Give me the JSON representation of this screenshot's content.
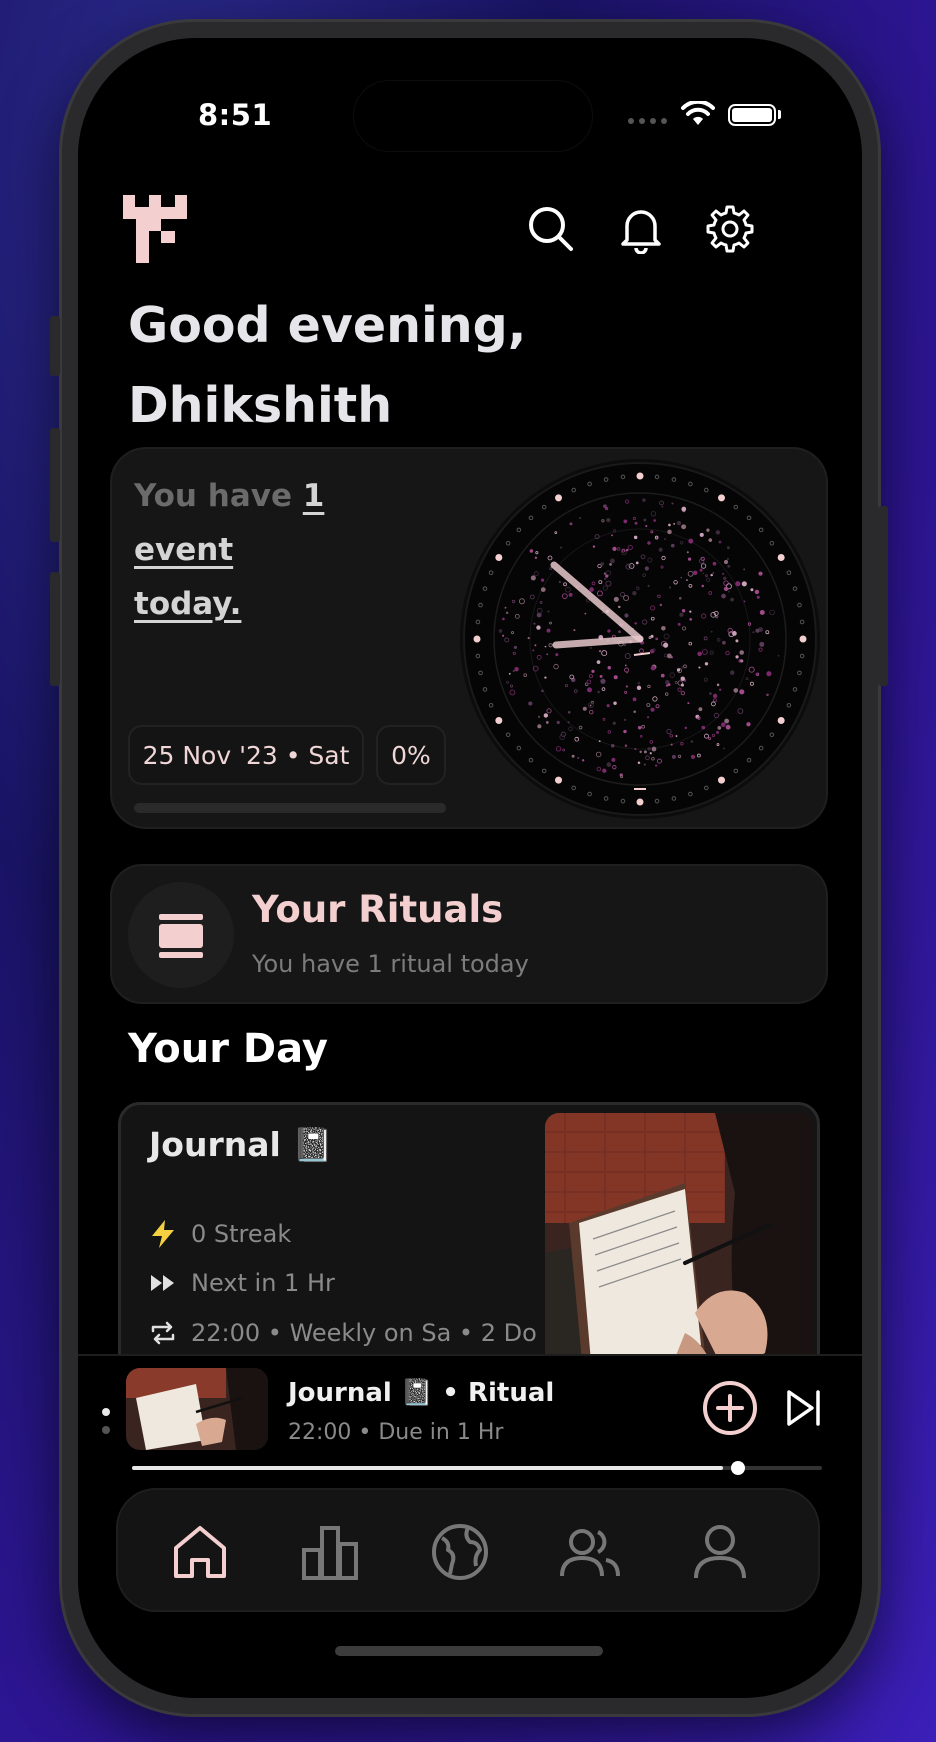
{
  "status_bar": {
    "time": "8:51"
  },
  "header": {
    "greeting_line1": "Good evening,",
    "greeting_line2": "Dhikshith",
    "icons": [
      "app-logo-icon",
      "search-icon",
      "bell-icon",
      "gear-icon"
    ]
  },
  "event_card": {
    "prefix": "You have ",
    "highlight_1": "1 event",
    "highlight_2": "today.",
    "date_pill": "25 Nov '23 • Sat",
    "percent_pill": "0%",
    "progress": 0
  },
  "rituals_card": {
    "title": "Your Rituals",
    "subtitle": "You have 1 ritual today"
  },
  "section_title": "Your Day",
  "journal_card": {
    "title": "Journal 📓",
    "streak": "0 Streak",
    "next": "Next in 1 Hr",
    "schedule": "22:00 • Weekly on Sa • 2 Do"
  },
  "mini_player": {
    "title": "Journal 📓  • Ritual",
    "subtitle": "22:00 • Due in 1 Hr",
    "progress": 0.9
  },
  "tabs": [
    "home-icon",
    "chart-icon",
    "globe-icon",
    "users-icon",
    "user-icon"
  ],
  "colors": {
    "accent": "#f3cfcf",
    "background": "#000000",
    "card": "#161616",
    "streak": "#f5d142"
  }
}
